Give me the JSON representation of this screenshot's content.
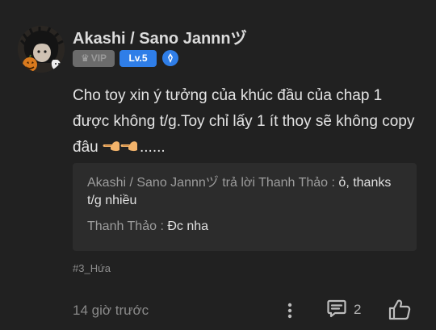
{
  "post": {
    "author": "Akashi / Sano Jannnヅ",
    "badges": {
      "vip_label": "VIP",
      "level_label": "Lv.5"
    },
    "content": {
      "text": "Cho toy xin ý tưởng của khúc đầu của chap 1 được không t/g.Toy chỉ lấy 1 ít thoy sẽ không copy đâu ",
      "trailing": "......",
      "emoji": "pointing-hands"
    },
    "quote": {
      "lines": [
        {
          "prefix": "Akashi / Sano Jannnヅ trả lời Thanh Thảo : ",
          "message": "ỏ, thanks t/g nhiều"
        },
        {
          "prefix": "Thanh Thảo : ",
          "message": "Đc nha"
        }
      ]
    },
    "tag": "#3_Hứa",
    "timestamp": "14 giờ trước",
    "comment_count": "2",
    "icons": {
      "more": "more-vertical-icon",
      "comment": "comment-icon",
      "like": "thumbs-up-icon",
      "rank": "rank-icon",
      "crown": "crown-icon"
    },
    "colors": {
      "background": "#212121",
      "level_badge": "#2f7ee8",
      "vip_badge": "#6b6b6b",
      "quote_background": "#2c2c2c"
    }
  }
}
